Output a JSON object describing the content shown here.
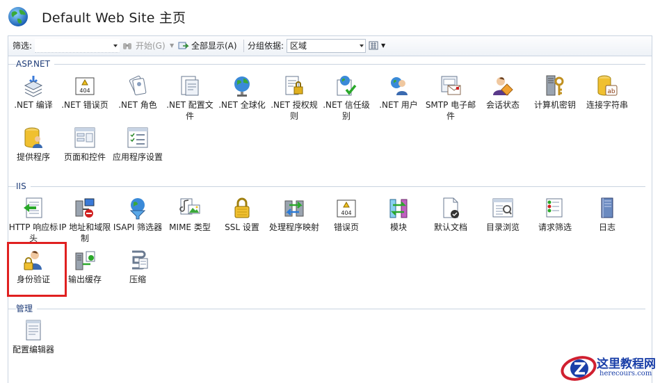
{
  "header": {
    "title": "Default Web Site 主页"
  },
  "toolbar": {
    "filter_label": "筛选:",
    "filter_value": "",
    "start_label": "开始(G)",
    "show_all_label": "全部显示(A)",
    "group_by_label": "分组依据:",
    "group_by_value": "区域"
  },
  "sections": {
    "aspnet": {
      "label": "ASP.NET",
      "items": [
        {
          "label": ".NET 编译",
          "icon": "compile-icon"
        },
        {
          "label": ".NET 错误页",
          "icon": "error-page-icon"
        },
        {
          "label": ".NET 角色",
          "icon": "roles-icon"
        },
        {
          "label": ".NET 配置文件",
          "icon": "profile-icon"
        },
        {
          "label": ".NET 全球化",
          "icon": "globe-icon"
        },
        {
          "label": ".NET 授权规则",
          "icon": "authorization-icon"
        },
        {
          "label": ".NET 信任级别",
          "icon": "trust-icon"
        },
        {
          "label": ".NET 用户",
          "icon": "users-icon"
        },
        {
          "label": "SMTP 电子邮件",
          "icon": "email-icon"
        },
        {
          "label": "会话状态",
          "icon": "session-icon"
        },
        {
          "label": "计算机密钥",
          "icon": "machine-key-icon"
        },
        {
          "label": "连接字符串",
          "icon": "connection-string-icon"
        },
        {
          "label": "提供程序",
          "icon": "providers-icon"
        },
        {
          "label": "页面和控件",
          "icon": "pages-controls-icon"
        },
        {
          "label": "应用程序设置",
          "icon": "app-settings-icon"
        }
      ]
    },
    "iis": {
      "label": "IIS",
      "items": [
        {
          "label": "HTTP 响应标头",
          "icon": "http-headers-icon"
        },
        {
          "label": "IP 地址和域限制",
          "icon": "ip-restrictions-icon"
        },
        {
          "label": "ISAPI 筛选器",
          "icon": "isapi-icon"
        },
        {
          "label": "MIME 类型",
          "icon": "mime-icon"
        },
        {
          "label": "SSL 设置",
          "icon": "ssl-lock-icon"
        },
        {
          "label": "处理程序映射",
          "icon": "handler-icon"
        },
        {
          "label": "错误页",
          "icon": "error-page-icon"
        },
        {
          "label": "模块",
          "icon": "modules-icon"
        },
        {
          "label": "默认文档",
          "icon": "default-doc-icon"
        },
        {
          "label": "目录浏览",
          "icon": "directory-browse-icon"
        },
        {
          "label": "请求筛选",
          "icon": "request-filter-icon"
        },
        {
          "label": "日志",
          "icon": "logging-icon"
        },
        {
          "label": "身份验证",
          "icon": "authentication-icon"
        },
        {
          "label": "输出缓存",
          "icon": "output-cache-icon"
        },
        {
          "label": "压缩",
          "icon": "compression-icon"
        }
      ]
    },
    "management": {
      "label": "管理",
      "items": [
        {
          "label": "配置编辑器",
          "icon": "config-editor-icon"
        }
      ]
    }
  },
  "watermark": {
    "title": "这里教程网",
    "subtitle": "herecours.com"
  },
  "colors": {
    "section_text": "#1e3c78",
    "highlight": "#e02020",
    "watermark": "#1a3fa8"
  }
}
